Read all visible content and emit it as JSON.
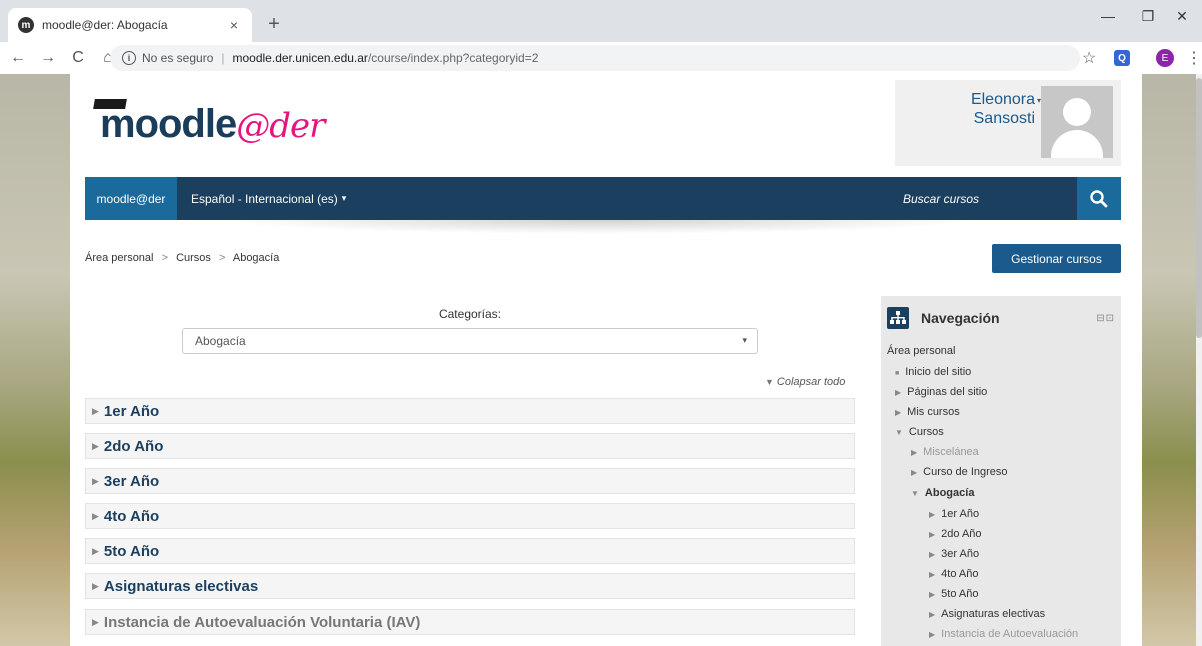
{
  "browser": {
    "tab_title": "moodle@der: Abogacía",
    "tab_favicon": "m",
    "tab_close": "×",
    "new_tab": "+",
    "window_minimize": "—",
    "window_restore": "❐",
    "window_close": "✕",
    "nav_back": "←",
    "nav_forward": "→",
    "nav_reload": "C",
    "nav_home": "⌂",
    "security_label": "No es seguro",
    "url_host": "moodle.der.unicen.edu.ar",
    "url_path": "/course/index.php?categoryid=2",
    "bookmark": "☆",
    "ext_label": "Q",
    "profile_initial": "E",
    "menu": "⋮"
  },
  "header": {
    "logo_main": "moodle",
    "logo_suffix": "@der",
    "user_first": "Eleonora",
    "user_last": "Sansosti",
    "user_caret": "▾"
  },
  "navbar": {
    "home": "moodle@der",
    "language": "Español - Internacional (es)",
    "language_caret": "▾",
    "search_placeholder": "Buscar cursos"
  },
  "breadcrumb": {
    "items": [
      "Área personal",
      "Cursos",
      "Abogacía"
    ],
    "separator": ">"
  },
  "manage_button": "Gestionar cursos",
  "categories": {
    "label": "Categorías:",
    "selected": "Abogacía",
    "select_arrow": "▾",
    "collapse_all": "Colapsar todo",
    "collapse_icon": "▼",
    "row_arrow": "▶",
    "rows": [
      "1er Año",
      "2do Año",
      "3er Año",
      "4to Año",
      "5to Año",
      "Asignaturas electivas",
      "Instancia de Autoevaluación Voluntaria (IAV)"
    ]
  },
  "navigation_block": {
    "title": "Navegación",
    "controls": "⊟⊡",
    "root": "Área personal",
    "bullet": "■",
    "arrow_closed": "▶",
    "arrow_open": "▼",
    "items": [
      "Inicio del sitio",
      "Páginas del sitio",
      "Mis cursos",
      "Cursos",
      "Miscelánea",
      "Curso de Ingreso",
      "Abogacía",
      "1er Año",
      "2do Año",
      "3er Año",
      "4to Año",
      "5to Año",
      "Asignaturas electivas",
      "Instancia de Autoevaluación"
    ]
  },
  "colors": {
    "navbar": "#1b3f5e",
    "accent": "#1a6b9c",
    "logo_pink": "#e5157f"
  }
}
